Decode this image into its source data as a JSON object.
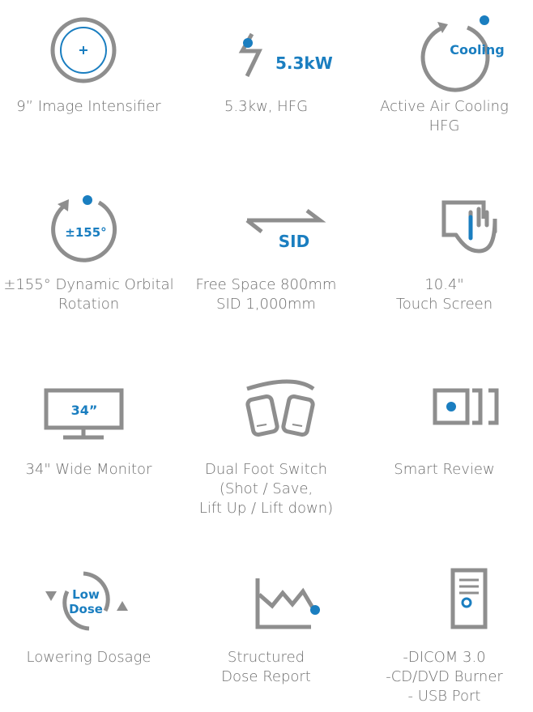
{
  "colors": {
    "gray": "#8e8e8e",
    "blue": "#1a7ec0",
    "text": "#6f6f6f"
  },
  "features": [
    {
      "icon": "image-intensifier-icon",
      "label": "9”  Image Intensifier"
    },
    {
      "icon": "power-lightning-icon",
      "icon_text": "5.3kW",
      "label": "5.3kw, HFG"
    },
    {
      "icon": "cooling-icon",
      "icon_text": "Cooling",
      "label": "Active Air Cooling\nHFG"
    },
    {
      "icon": "orbital-rotation-icon",
      "icon_text": "±155°",
      "label": "±155° Dynamic Orbital\nRotation"
    },
    {
      "icon": "sid-arrows-icon",
      "icon_text": "SID",
      "label": "Free Space 800mm\nSID 1,000mm"
    },
    {
      "icon": "touch-screen-icon",
      "label": "10.4\"\nTouch Screen"
    },
    {
      "icon": "monitor-icon",
      "icon_text": "34”",
      "label": "34\" Wide Monitor"
    },
    {
      "icon": "foot-switch-icon",
      "label": "Dual Foot Switch\n(Shot / Save,\nLift Up / Lift down)"
    },
    {
      "icon": "smart-review-icon",
      "label": "Smart Review"
    },
    {
      "icon": "low-dose-icon",
      "icon_text": "Low\nDose",
      "label": "Lowering Dosage"
    },
    {
      "icon": "dose-report-icon",
      "label": "Structured\nDose Report"
    },
    {
      "icon": "computer-tower-icon",
      "label": "-DICOM 3.0\n-CD/DVD Burner\n- USB Port"
    }
  ]
}
